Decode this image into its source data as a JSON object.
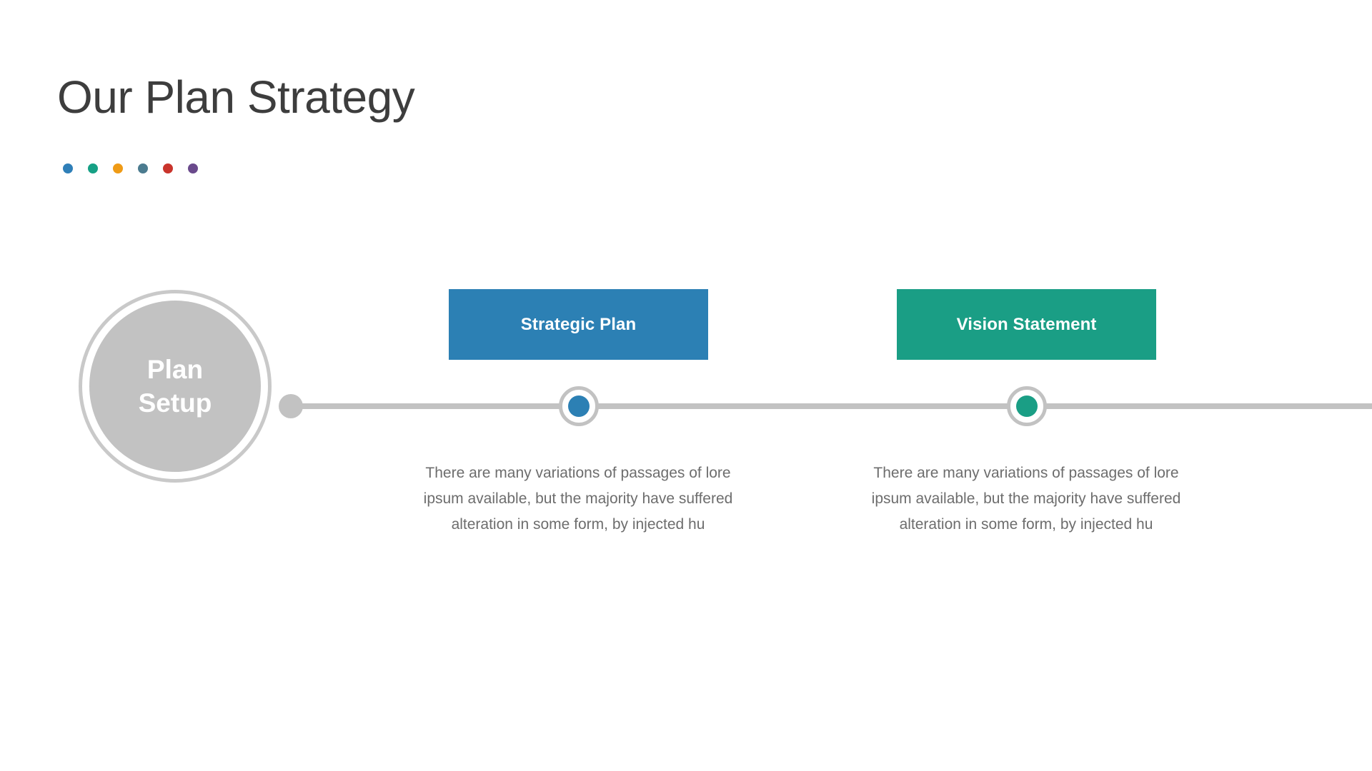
{
  "header": {
    "title": "Our Plan Strategy",
    "title_color": "#3d3d3d",
    "accent_dots": [
      {
        "name": "dot-blue",
        "color": "#2f7fb8"
      },
      {
        "name": "dot-green",
        "color": "#16a085"
      },
      {
        "name": "dot-orange",
        "color": "#ef9b16"
      },
      {
        "name": "dot-steel",
        "color": "#4b7b8f"
      },
      {
        "name": "dot-red",
        "color": "#c9342c"
      },
      {
        "name": "dot-purple",
        "color": "#6a4a8c"
      }
    ]
  },
  "timeline": {
    "line_color": "#c2c2c2",
    "start_dot_color": "#c2c2c2",
    "origin": {
      "label_line_1": "Plan",
      "label_line_2": "Setup",
      "fill_color": "#c2c2c2",
      "ring_color": "#c9c9c9",
      "text_color": "#ffffff"
    },
    "steps": [
      {
        "id": "strategic-plan",
        "label": "Strategic Plan",
        "color": "#2c80b4",
        "marker_color": "#2c80b4",
        "marker_ring_color": "#c2c2c2",
        "description": "There are many variations of passages of lore ipsum available, but the majority have suffered alteration in some form, by injected hu"
      },
      {
        "id": "vision-statement",
        "label": "Vision Statement",
        "color": "#1a9e85",
        "marker_color": "#1a9e85",
        "marker_ring_color": "#c2c2c2",
        "description": "There are many variations of passages of lore ipsum available, but the majority have suffered alteration in some form, by injected hu"
      }
    ]
  }
}
